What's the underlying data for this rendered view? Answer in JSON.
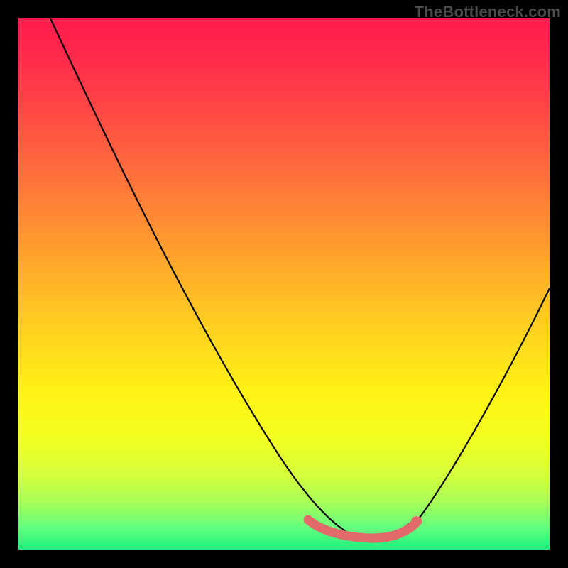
{
  "watermark": "TheBottleneck.com",
  "chart_data": {
    "type": "line",
    "title": "",
    "xlabel": "",
    "ylabel": "",
    "xlim": [
      0,
      100
    ],
    "ylim": [
      0,
      100
    ],
    "grid": false,
    "legend": false,
    "series": [
      {
        "name": "left-curve",
        "x": [
          6,
          10,
          15,
          20,
          25,
          30,
          35,
          40,
          45,
          50,
          55,
          58,
          60,
          62
        ],
        "y": [
          100,
          92,
          83,
          74,
          65,
          56,
          47,
          38,
          29,
          20,
          11,
          6,
          4,
          3
        ]
      },
      {
        "name": "right-curve",
        "x": [
          74,
          78,
          82,
          86,
          90,
          94,
          98,
          100
        ],
        "y": [
          4,
          8,
          14,
          21,
          29,
          37,
          45,
          49
        ]
      },
      {
        "name": "bottom-pink",
        "x": [
          55,
          58,
          60,
          62,
          64,
          66,
          68,
          70,
          72,
          74,
          75
        ],
        "y": [
          5.2,
          3.8,
          3.2,
          2.8,
          2.6,
          2.6,
          2.7,
          3.0,
          3.6,
          4.6,
          5.4
        ]
      }
    ],
    "colors": {
      "gradient_top": "#ff1a4e",
      "gradient_mid": "#ffe81a",
      "gradient_bottom": "#1cf07a",
      "curve": "#000000",
      "pink_curve": "#e36a6a"
    }
  }
}
